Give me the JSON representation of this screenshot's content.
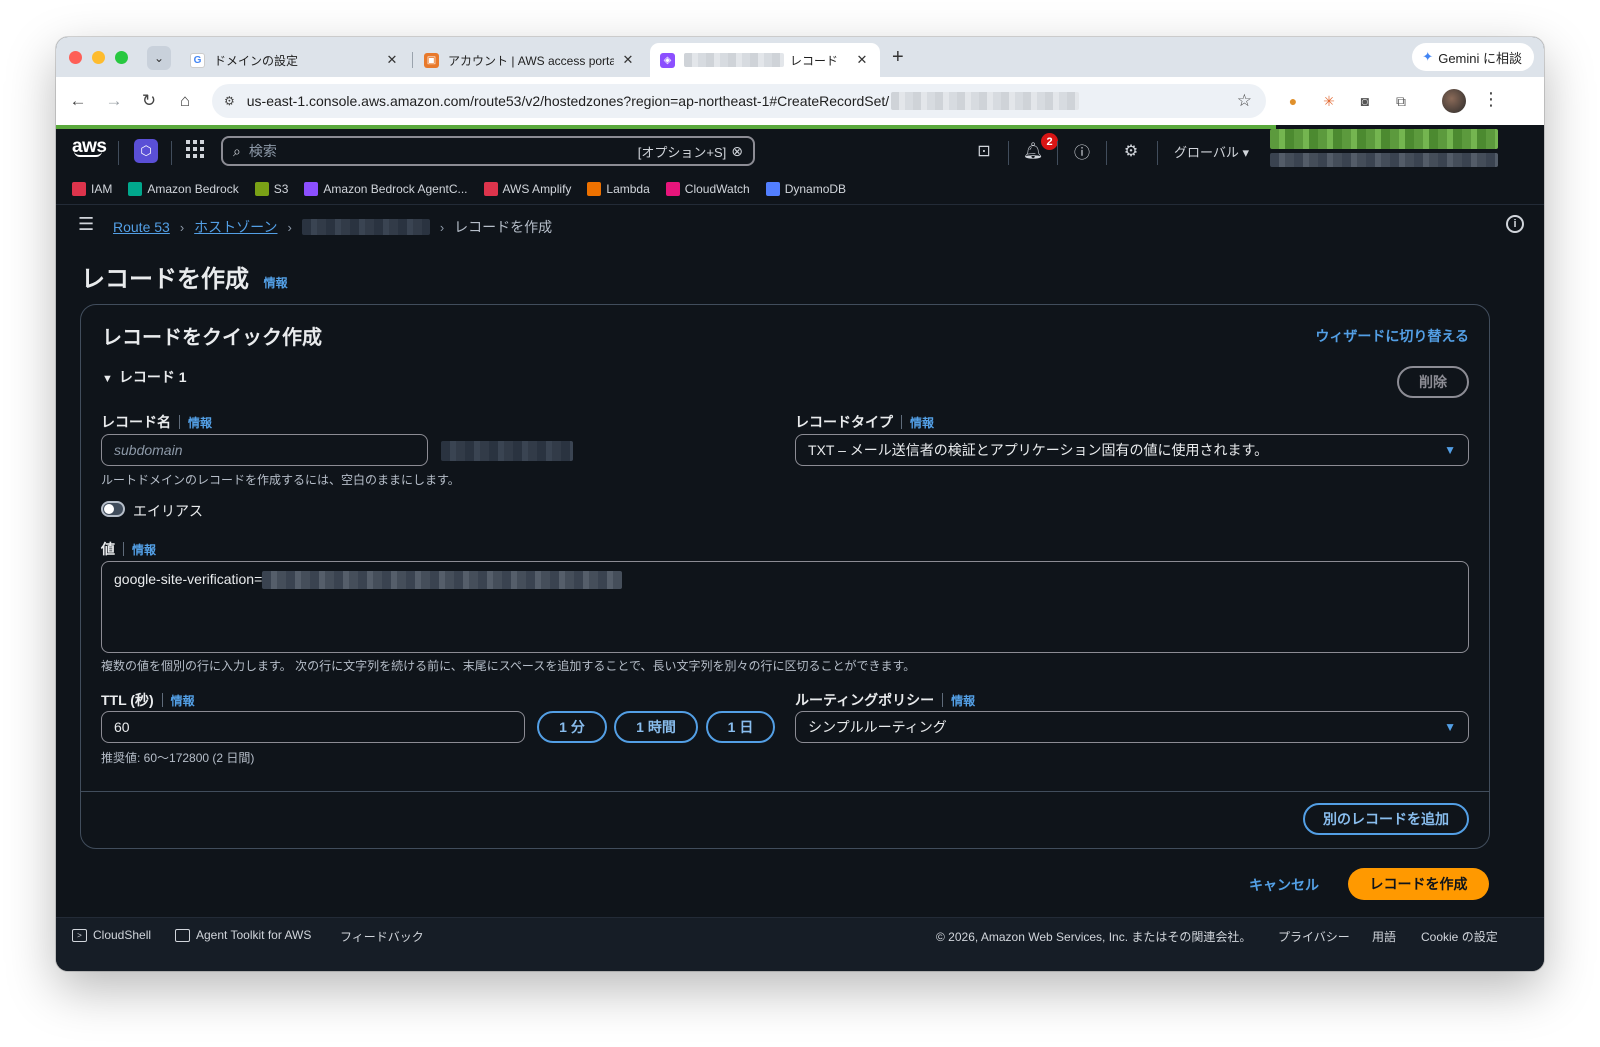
{
  "browser": {
    "tabs": [
      {
        "title": "ドメインの設定",
        "close": "✕",
        "active": false
      },
      {
        "title": "アカウント | AWS access porta",
        "close": "✕",
        "active": false
      },
      {
        "title": "レコード",
        "close": "✕",
        "active": true
      }
    ],
    "new_tab": "+",
    "gemini_label": "Gemini に相談",
    "url": "us-east-1.console.aws.amazon.com/route53/v2/hostedzones?region=ap-northeast-1#CreateRecordSet/"
  },
  "aws_nav": {
    "logo": "aws",
    "search_placeholder": "検索",
    "search_shortcut": "[オプション+S]",
    "notification_count": "2",
    "region": "グローバル ▾"
  },
  "favorites": [
    {
      "label": "IAM",
      "color": "#dd344c"
    },
    {
      "label": "Amazon Bedrock",
      "color": "#01a88d"
    },
    {
      "label": "S3",
      "color": "#7aa116"
    },
    {
      "label": "Amazon Bedrock AgentC...",
      "color": "#8c4fff"
    },
    {
      "label": "AWS Amplify",
      "color": "#dd344c"
    },
    {
      "label": "Lambda",
      "color": "#ed7100"
    },
    {
      "label": "CloudWatch",
      "color": "#e7157b"
    },
    {
      "label": "DynamoDB",
      "color": "#527fff"
    }
  ],
  "breadcrumbs": {
    "route53": "Route 53",
    "hosted_zones": "ホストゾーン",
    "current": "レコードを作成"
  },
  "page": {
    "title": "レコードを作成",
    "info": "情報"
  },
  "panel": {
    "title": "レコードをクイック作成",
    "wizard_link": "ウィザードに切り替える",
    "record_expander": "レコード 1",
    "delete_button": "削除",
    "record_name": {
      "label": "レコード名",
      "info": "情報",
      "placeholder": "subdomain",
      "hint": "ルートドメインのレコードを作成するには、空白のままにします。"
    },
    "record_type": {
      "label": "レコードタイプ",
      "info": "情報",
      "value": "TXT – メール送信者の検証とアプリケーション固有の値に使用されます。"
    },
    "alias": {
      "label": "エイリアス"
    },
    "value": {
      "label": "値",
      "info": "情報",
      "text": "google-site-verification=",
      "hint": "複数の値を個別の行に入力します。 次の行に文字列を続ける前に、末尾にスペースを追加することで、長い文字列を別々の行に区切ることができます。"
    },
    "ttl": {
      "label": "TTL (秒)",
      "info": "情報",
      "value": "60",
      "hint": "推奨値: 60～172800 (2 日間)",
      "presets": [
        "1 分",
        "1 時間",
        "1 日"
      ]
    },
    "routing_policy": {
      "label": "ルーティングポリシー",
      "info": "情報",
      "value": "シンプルルーティング"
    },
    "add_record_button": "別のレコードを追加"
  },
  "actions": {
    "cancel": "キャンセル",
    "create": "レコードを作成"
  },
  "footer": {
    "cloudshell": "CloudShell",
    "agent_toolkit": "Agent Toolkit for AWS",
    "feedback": "フィードバック",
    "copyright": "© 2026, Amazon Web Services, Inc. またはその関連会社。",
    "privacy": "プライバシー",
    "terms": "用語",
    "cookie": "Cookie の設定"
  }
}
